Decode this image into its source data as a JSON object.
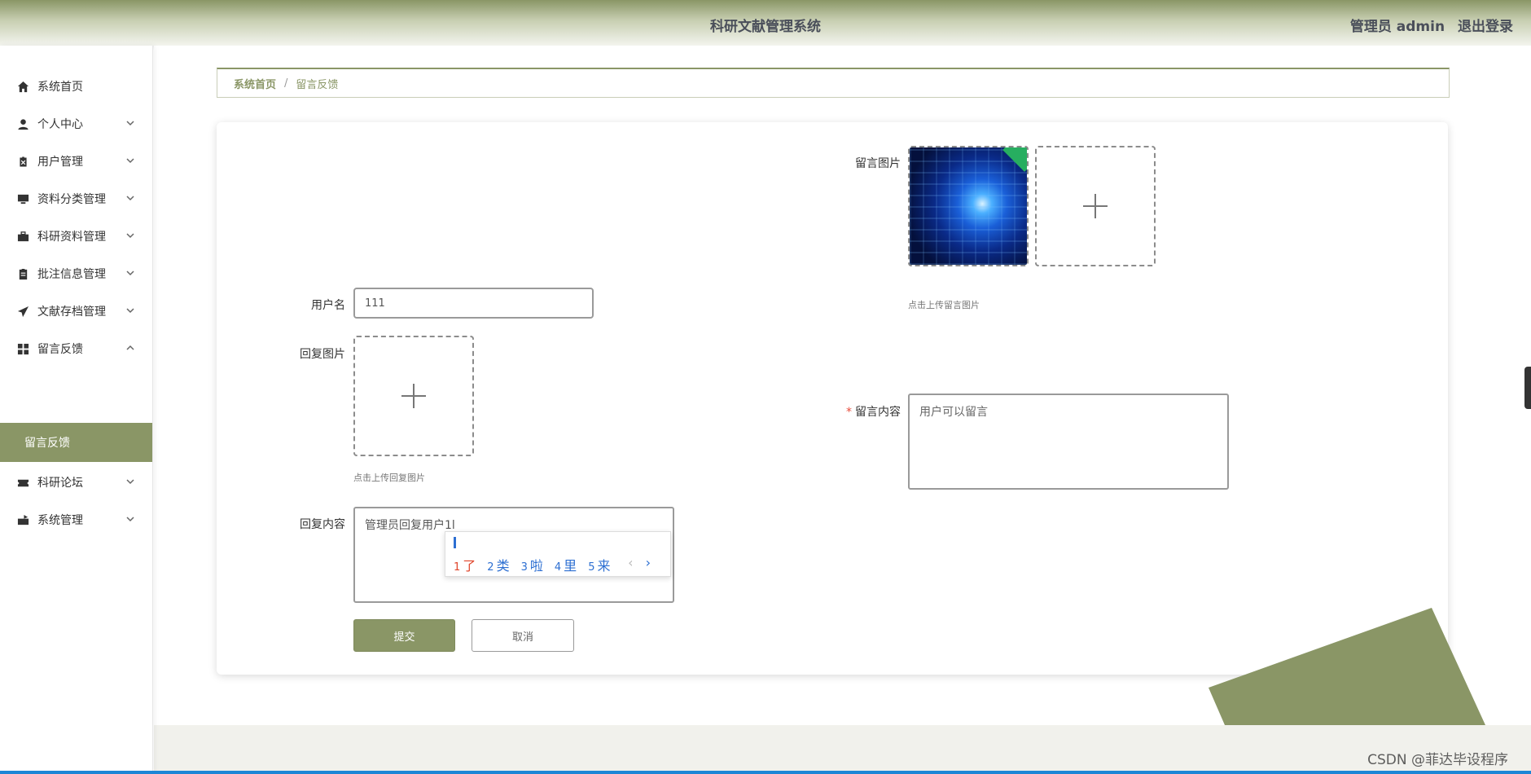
{
  "header": {
    "title": "科研文献管理系统",
    "user_label": "管理员 admin",
    "logout_label": "退出登录"
  },
  "sidebar": {
    "items": [
      {
        "label": "系统首页",
        "icon": "home-icon"
      },
      {
        "label": "个人中心",
        "icon": "user-icon"
      },
      {
        "label": "用户管理",
        "icon": "clipboard-x-icon"
      },
      {
        "label": "资料分类管理",
        "icon": "monitor-icon"
      },
      {
        "label": "科研资料管理",
        "icon": "briefcase-icon"
      },
      {
        "label": "批注信息管理",
        "icon": "clipboard-icon"
      },
      {
        "label": "文献存档管理",
        "icon": "paper-plane-icon"
      },
      {
        "label": "留言反馈",
        "icon": "grid-icon"
      },
      {
        "label": "科研论坛",
        "icon": "ticket-icon"
      },
      {
        "label": "系统管理",
        "icon": "briefcase-plus-icon"
      }
    ],
    "active_sub": "留言反馈"
  },
  "breadcrumb": {
    "home": "系统首页",
    "separator": "/",
    "current": "留言反馈"
  },
  "form": {
    "username_label": "用户名",
    "username_value": "111",
    "msg_image_label": "留言图片",
    "msg_image_hint": "点击上传留言图片",
    "reply_image_label": "回复图片",
    "reply_image_hint": "点击上传回复图片",
    "msg_content_label": "留言内容",
    "msg_content_required": "*",
    "msg_content_placeholder": "用户可以留言",
    "reply_content_label": "回复内容",
    "reply_content_value": "管理员回复用户1l",
    "submit_label": "提交",
    "cancel_label": "取消"
  },
  "ime": {
    "candidates": [
      {
        "n": "1",
        "t": "了"
      },
      {
        "n": "2",
        "t": "类"
      },
      {
        "n": "3",
        "t": "啦"
      },
      {
        "n": "4",
        "t": "里"
      },
      {
        "n": "5",
        "t": "来"
      }
    ],
    "prev": "‹",
    "next": "›"
  },
  "watermark": "CSDN @菲达毕设程序",
  "colors": {
    "accent": "#8a9666",
    "required": "#e74c3c"
  }
}
